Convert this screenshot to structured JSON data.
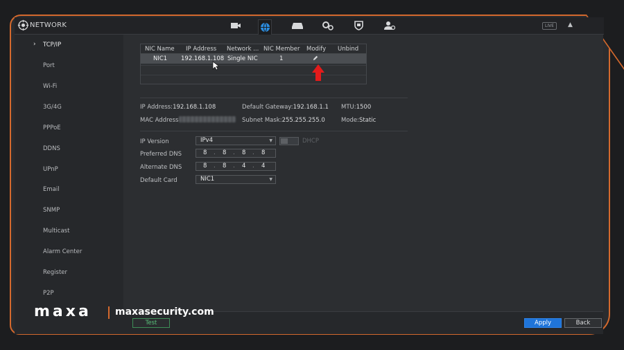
{
  "header": {
    "title": "NETWORK",
    "icons": [
      "camera-icon",
      "network-globe-icon",
      "storage-icon",
      "settings-icon",
      "security-shield-icon",
      "account-icon"
    ],
    "live_label": "LIVE"
  },
  "sidebar": {
    "items": [
      {
        "label": "TCP/IP",
        "active": true
      },
      {
        "label": "Port"
      },
      {
        "label": "Wi-Fi"
      },
      {
        "label": "3G/4G"
      },
      {
        "label": "PPPoE"
      },
      {
        "label": "DDNS"
      },
      {
        "label": "UPnP"
      },
      {
        "label": "Email"
      },
      {
        "label": "SNMP"
      },
      {
        "label": "Multicast"
      },
      {
        "label": "Alarm Center"
      },
      {
        "label": "Register"
      },
      {
        "label": "P2P"
      }
    ]
  },
  "nic_table": {
    "headers": [
      "NIC Name",
      "IP Address",
      "Network ...",
      "NIC Member",
      "Modify",
      "Unbind"
    ],
    "rows": [
      {
        "nic_name": "NIC1",
        "ip_address": "192.168.1.108",
        "network": "Single NIC",
        "nic_member": "1"
      }
    ]
  },
  "info": {
    "ip_address_label": "IP Address:",
    "ip_address": "192.168.1.108",
    "gateway_label": "Default Gateway:",
    "gateway": "192.168.1.1",
    "mtu_label": "MTU:",
    "mtu": "1500",
    "mac_label": "MAC Address",
    "subnet_label": "Subnet Mask:",
    "subnet": "255.255.255.0",
    "mode_label": "Mode:",
    "mode": "Static"
  },
  "form": {
    "ip_version_label": "IP Version",
    "ip_version": "IPv4",
    "dhcp_label": "DHCP",
    "preferred_dns_label": "Preferred DNS",
    "preferred_dns": [
      "8",
      "8",
      "8",
      "8"
    ],
    "alternate_dns_label": "Alternate DNS",
    "alternate_dns": [
      "8",
      "8",
      "4",
      "4"
    ],
    "default_card_label": "Default Card",
    "default_card": "NIC1"
  },
  "buttons": {
    "test": "Test",
    "apply": "Apply",
    "back": "Back"
  },
  "watermark": {
    "brand": "maxa",
    "site": "maxasecurity.com"
  },
  "colors": {
    "accent_orange": "#d4692d",
    "apply_blue": "#1f74d8",
    "test_green": "#59c07a",
    "arrow_red": "#e31b1b"
  }
}
